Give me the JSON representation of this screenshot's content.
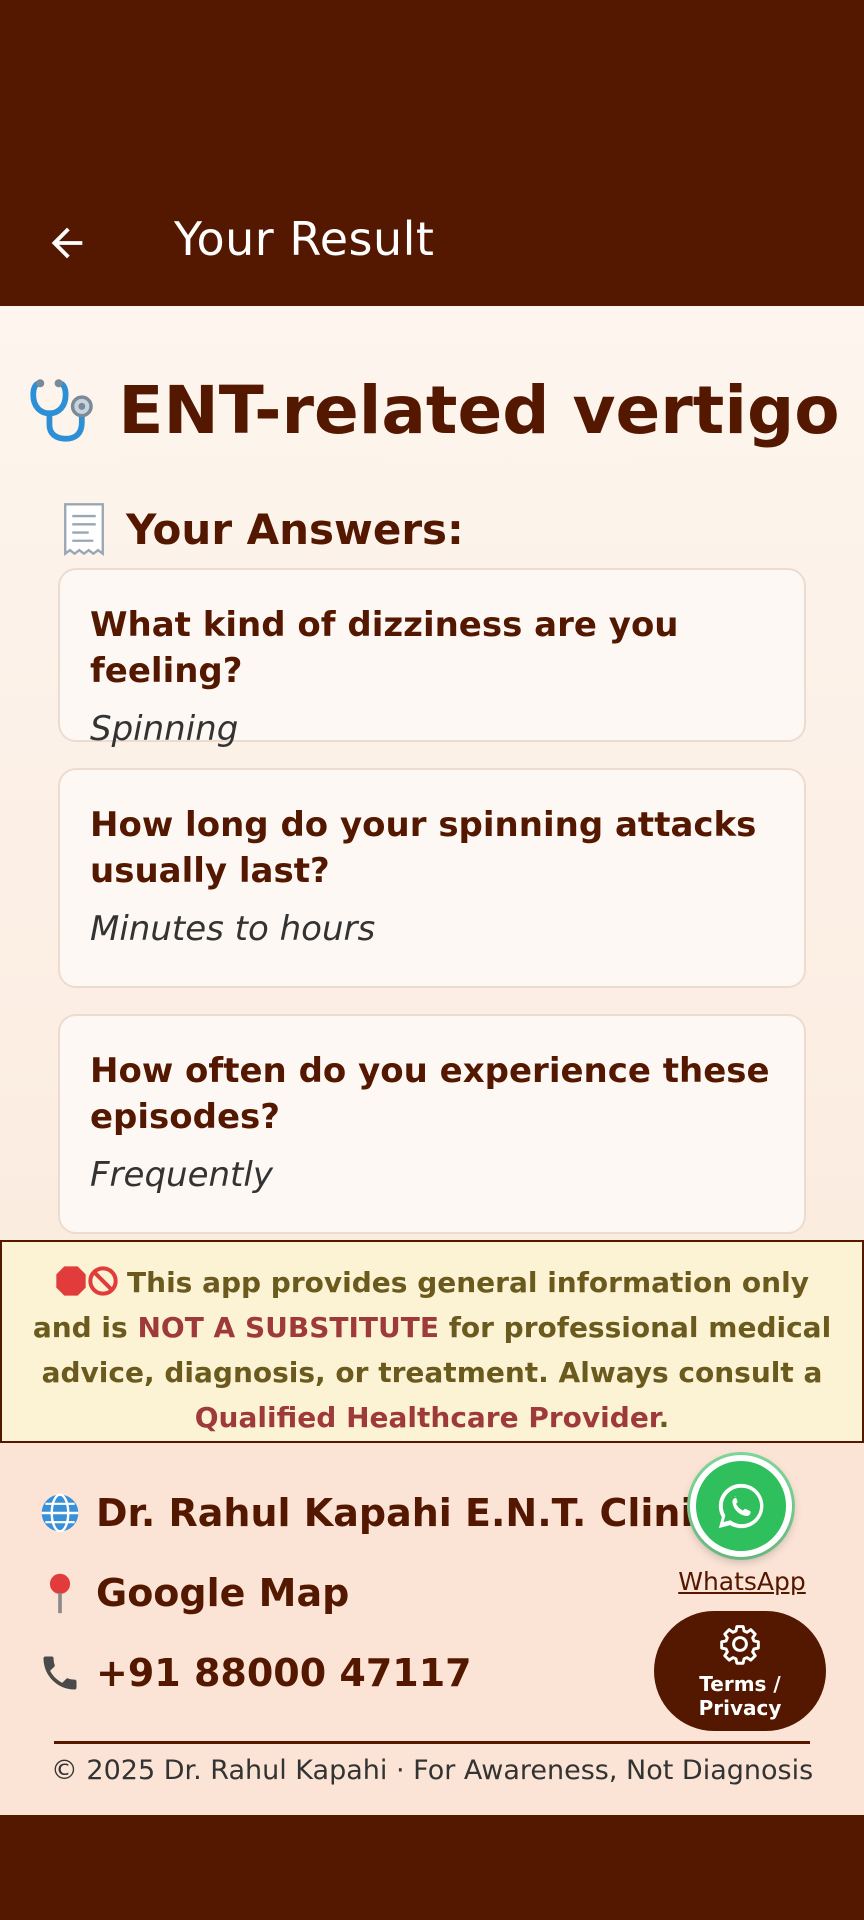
{
  "app_bar": {
    "title": "Your Result",
    "back_icon": "arrow-left-icon"
  },
  "result": {
    "icon": "stethoscope-icon",
    "title": "ENT-related vertigo"
  },
  "answers": {
    "icon": "receipt-icon",
    "heading": "Your Answers:",
    "items": [
      {
        "question": "What kind of dizziness are you feeling?",
        "answer": "Spinning"
      },
      {
        "question": "How long do your spinning attacks usually last?",
        "answer": "Minutes to hours"
      },
      {
        "question": "How often do you experience these episodes?",
        "answer": "Frequently"
      }
    ]
  },
  "disclaimer": {
    "icons": [
      "stop-sign-icon",
      "prohibited-icon"
    ],
    "text_1": "This app provides general information only and is ",
    "highlight_1": "NOT A SUBSTITUTE",
    "text_2": " for professional medical advice, diagnosis, or treatment. Always consult a ",
    "highlight_2": "Qualified Healthcare Provider",
    "text_3": "."
  },
  "footer": {
    "clinic": {
      "icon": "globe-icon",
      "label": "Dr. Rahul Kapahi E.N.T. Clinic"
    },
    "map": {
      "icon": "pin-icon",
      "label": "Google Map"
    },
    "phone": {
      "icon": "phone-icon",
      "label": "+91 88000 47117"
    },
    "whatsapp": {
      "icon": "whatsapp-icon",
      "label": "WhatsApp"
    },
    "terms": {
      "icon": "gear-icon",
      "label": "Terms / Privacy"
    },
    "copyright": "© 2025 Dr. Rahul Kapahi · For Awareness, Not Diagnosis"
  },
  "colors": {
    "primary": "#541800",
    "background": "#fbf1e8",
    "disclaimer_bg": "#fcf3d4",
    "disclaimer_highlight": "#9e3a3a",
    "whatsapp_green": "#2fbf5c"
  }
}
